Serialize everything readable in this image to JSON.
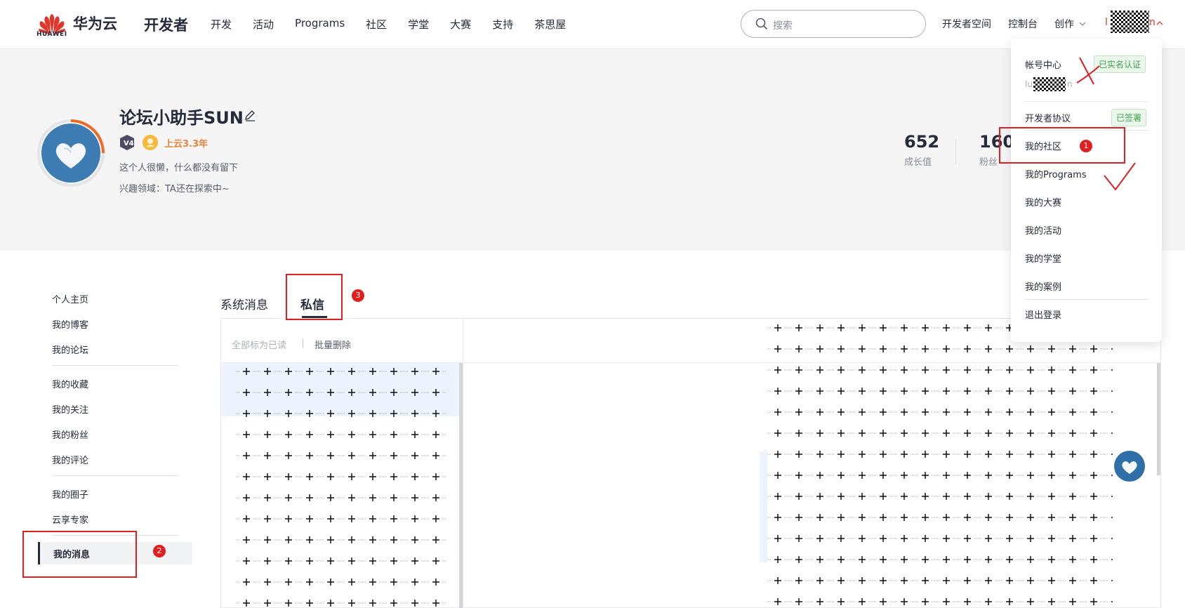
{
  "header": {
    "brand": "华为云",
    "logo_sub": "HUAWEI",
    "dev_title": "开发者",
    "nav": [
      "开发",
      "活动",
      "Programs",
      "社区",
      "学堂",
      "大赛",
      "支持",
      "茶思屋"
    ],
    "search_placeholder": "搜索",
    "right_nav": {
      "dev_space": "开发者空间",
      "console": "控制台",
      "create": "创作",
      "user_prefix": "l",
      "user_suffix": "n"
    }
  },
  "profile": {
    "name": "论坛小助手SUN",
    "cloud_years": "上云3.3年",
    "bio": "这个人很懒，什么都没有留下",
    "interest": "兴趣领域：TA还在探索中~",
    "stats": [
      {
        "value": "652",
        "label": "成长值"
      },
      {
        "value": "160",
        "label": "粉丝"
      }
    ]
  },
  "sidebar": {
    "groups": [
      [
        "个人主页",
        "我的博客",
        "我的论坛"
      ],
      [
        "我的收藏",
        "我的关注",
        "我的粉丝",
        "我的评论"
      ],
      [
        "我的圈子",
        "云享专家"
      ]
    ],
    "active": "我的消息"
  },
  "messages": {
    "tabs": [
      "系统消息",
      "私信"
    ],
    "active_tab": "私信",
    "toolbar": {
      "mark_all_read": "全部标为已读",
      "batch_delete": "批量删除"
    }
  },
  "dropdown": {
    "account_center": "帐号中心",
    "verified_tag": "已实名认证",
    "username_prefix": "lu",
    "username_suffix": "n",
    "dev_agreement": "开发者协议",
    "signed_tag": "已签署",
    "items": [
      "我的社区",
      "我的Programs",
      "我的大赛",
      "我的活动",
      "我的学堂",
      "我的案例"
    ],
    "logout": "退出登录"
  },
  "annotations": [
    "1",
    "2",
    "3"
  ],
  "colors": {
    "brand_red": "#e0372d",
    "annotation_red": "#e02020",
    "success_green": "#3fa24f",
    "cloud_years_orange": "#e8833a"
  },
  "icons": [
    "huawei-logo-icon",
    "search-icon",
    "edit-icon",
    "level-v4-icon",
    "cloud-badge-icon",
    "chevron-down-icon",
    "avatar-heart-icon"
  ]
}
